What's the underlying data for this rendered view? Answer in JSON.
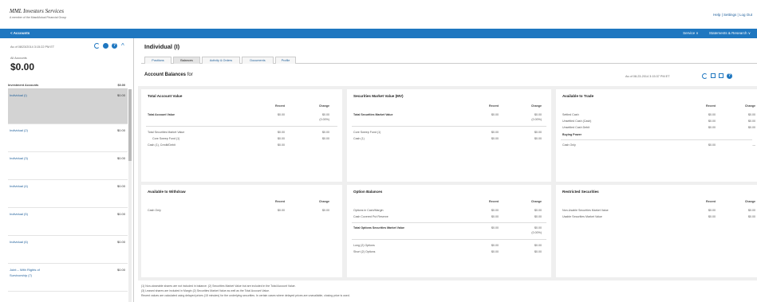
{
  "header": {
    "logo_main": "MML Investors Services",
    "logo_sub": "A member of the MassMutual Financial Group",
    "top_links": "Help | Settings | Log Out"
  },
  "nav": {
    "left": "< Accounts",
    "right_items": [
      "Service ∨",
      "Statements & Research ∨"
    ]
  },
  "sidebar": {
    "as_of": "As of 08/23/2014 3:15:22 PM ET",
    "all_label": "All Accounts",
    "total": "$0.00",
    "inv_header": "Investment Accounts",
    "inv_header_value": "$0.00",
    "accounts": [
      {
        "name": "Individual (I)",
        "value": "$0.00",
        "selected": true
      },
      {
        "name": "Individual (2)",
        "value": "$0.00"
      },
      {
        "name": "Individual (3)",
        "value": "$0.00"
      },
      {
        "name": "Individual (4)",
        "value": "$0.00"
      },
      {
        "name": "Individual (5)",
        "value": "$0.00"
      },
      {
        "name": "Individual (6)",
        "value": "$0.00"
      },
      {
        "name": "Joint – With Rights of",
        "name2": "Survivorship (7)",
        "value": "$0.00"
      }
    ]
  },
  "main": {
    "title": "Individual (I)",
    "tabs": [
      "Positions",
      "Balances",
      "Activity & Orders",
      "Documents",
      "Profile"
    ],
    "section_title": "Account Balances",
    "section_for": "for",
    "as_of": "As of 08-23-2014 3:15:37 PM ET"
  },
  "panels": {
    "total_value": {
      "title": "Total Account Value",
      "col_recent": "Recent",
      "col_change": "Change",
      "rows": [
        {
          "label": "Total Account Value",
          "recent": "$0.00",
          "change": "$0.00",
          "change2": "(0.00%)",
          "bold": true
        },
        {
          "label": "Total Securities Market Value",
          "recent": "$0.00",
          "change": "$0.00"
        },
        {
          "label": "Core Sweep Fund (1)",
          "recent": "$0.00",
          "change": "$0.00"
        },
        {
          "label": "Cash (1), Credit/Debit",
          "recent": "$0.00",
          "change": ""
        }
      ]
    },
    "securities": {
      "title": "Securities Market Value (MV)",
      "col_recent": "Recent",
      "col_change": "Change",
      "rows": [
        {
          "label": "Total Securities Market Value",
          "recent": "$0.00",
          "change": "$0.00",
          "change2": "(0.00%)",
          "bold": true
        },
        {
          "label": "Core Sweep Fund (1)",
          "recent": "$0.00",
          "change": "$0.00"
        },
        {
          "label": "Cash (1)",
          "recent": "$0.00",
          "change": "$0.00"
        }
      ]
    },
    "available_trade": {
      "title": "Available to Trade",
      "col_recent": "Recent",
      "col_change": "Change",
      "rows": [
        {
          "label": "Settled Cash",
          "recent": "$0.00",
          "change": "$0.00"
        },
        {
          "label": "Unsettled Cash (Cash)",
          "recent": "$0.00",
          "change": "$0.00"
        },
        {
          "label": "Unsettled Cash Debit",
          "recent": "$0.00",
          "change": "$0.00"
        },
        {
          "label": "Buying Power",
          "recent": "",
          "change": "",
          "bold": true
        },
        {
          "label": "Cash Only",
          "recent": "$0.00",
          "change": "—"
        }
      ]
    },
    "withdraw": {
      "title": "Available to Withdraw",
      "col_recent": "Recent",
      "col_change": "Change",
      "rows": [
        {
          "label": "Cash Only",
          "recent": "$0.00",
          "change": "$0.00"
        }
      ]
    },
    "options": {
      "title": "Option Balances",
      "col_recent": "Recent",
      "col_change": "Change",
      "rows": [
        {
          "label": "Options in Cash/Margin",
          "recent": "$0.00",
          "change": "$0.00"
        },
        {
          "label": "Cash Covered Put Reserve",
          "recent": "$0.00",
          "change": "$0.00"
        },
        {
          "label": "Total Options Securities Market Value",
          "recent": "$0.00",
          "change": "$0.00",
          "change2": "(0.00%)",
          "bold": true
        },
        {
          "label": "Long (2) Options",
          "recent": "$0.00",
          "change": "$0.00"
        },
        {
          "label": "Short (2) Options",
          "recent": "$0.00",
          "change": "$0.00"
        }
      ]
    },
    "restricted": {
      "title": "Restricted Securities",
      "col_recent": "Recent",
      "col_change": "Change",
      "rows": [
        {
          "label": "Non-Usable Securities Market Value",
          "recent": "$0.00",
          "change": "$0.00"
        },
        {
          "label": "Usable Securities Market Value",
          "recent": "$0.00",
          "change": "$0.00"
        }
      ]
    }
  },
  "footnotes": [
    "(1) Non-closeable shares are not included in balance. (2) Securities Market Value but are included in the Total Account Value.",
    "(3) Leased shares are included in Margin (2) Securities Market Value as well as the Total Account Value.",
    "Recent values are calculated using delayed prices (15 minutes) for the underlying securities. In certain cases where delayed prices are unavailable, closing price is used."
  ],
  "colors": {
    "accent": "#1f77c0",
    "link": "#1f5f9a",
    "panel_bg": "#efefef",
    "selected": "#d3d3d3"
  }
}
